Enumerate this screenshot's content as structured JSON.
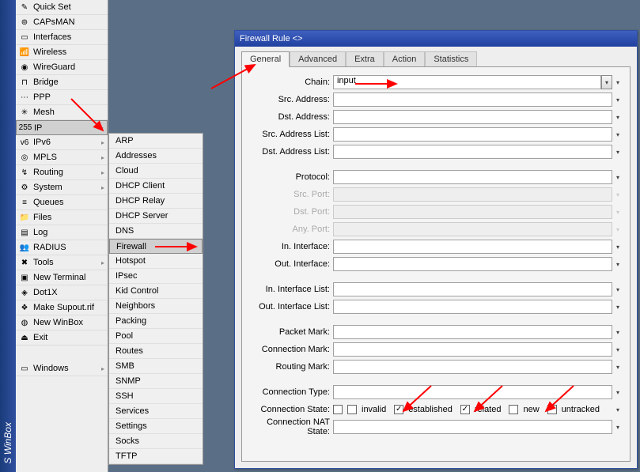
{
  "app": {
    "strip_text": "S WinBox"
  },
  "menu1": [
    {
      "icon": "✎",
      "label": "Quick Set",
      "arrow": false
    },
    {
      "icon": "⊚",
      "label": "CAPsMAN",
      "arrow": false
    },
    {
      "icon": "▭",
      "label": "Interfaces",
      "arrow": false
    },
    {
      "icon": "📶",
      "label": "Wireless",
      "arrow": false
    },
    {
      "icon": "◉",
      "label": "WireGuard",
      "arrow": false
    },
    {
      "icon": "⊓",
      "label": "Bridge",
      "arrow": false
    },
    {
      "icon": "⋯",
      "label": "PPP",
      "arrow": false
    },
    {
      "icon": "✳",
      "label": "Mesh",
      "arrow": false
    },
    {
      "icon": "255",
      "label": "IP",
      "arrow": true,
      "selected": true
    },
    {
      "icon": "v6",
      "label": "IPv6",
      "arrow": true
    },
    {
      "icon": "◎",
      "label": "MPLS",
      "arrow": true
    },
    {
      "icon": "↯",
      "label": "Routing",
      "arrow": true
    },
    {
      "icon": "⚙",
      "label": "System",
      "arrow": true
    },
    {
      "icon": "≡",
      "label": "Queues",
      "arrow": false
    },
    {
      "icon": "📁",
      "label": "Files",
      "arrow": false
    },
    {
      "icon": "▤",
      "label": "Log",
      "arrow": false
    },
    {
      "icon": "👥",
      "label": "RADIUS",
      "arrow": false
    },
    {
      "icon": "✖",
      "label": "Tools",
      "arrow": true
    },
    {
      "icon": "▣",
      "label": "New Terminal",
      "arrow": false
    },
    {
      "icon": "◈",
      "label": "Dot1X",
      "arrow": false
    },
    {
      "icon": "❖",
      "label": "Make Supout.rif",
      "arrow": false
    },
    {
      "icon": "◍",
      "label": "New WinBox",
      "arrow": false
    },
    {
      "icon": "⏏",
      "label": "Exit",
      "arrow": false
    },
    {
      "spacer": true
    },
    {
      "icon": "▭",
      "label": "Windows",
      "arrow": true
    }
  ],
  "submenu": [
    "ARP",
    "Addresses",
    "Cloud",
    "DHCP Client",
    "DHCP Relay",
    "DHCP Server",
    "DNS",
    "Firewall",
    "Hotspot",
    "IPsec",
    "Kid Control",
    "Neighbors",
    "Packing",
    "Pool",
    "Routes",
    "SMB",
    "SNMP",
    "SSH",
    "Services",
    "Settings",
    "Socks",
    "TFTP"
  ],
  "submenu_highlight": "Firewall",
  "fw": {
    "title": "Firewall Rule <>",
    "tabs": [
      "General",
      "Advanced",
      "Extra",
      "Action",
      "Statistics"
    ],
    "active_tab": "General",
    "fields": {
      "chain": {
        "label": "Chain:",
        "value": "input",
        "enabled": true,
        "drop": "dbl"
      },
      "srcaddr": {
        "label": "Src. Address:",
        "enabled": true
      },
      "dstaddr": {
        "label": "Dst. Address:",
        "enabled": true
      },
      "srclist": {
        "label": "Src. Address List:",
        "enabled": true
      },
      "dstlist": {
        "label": "Dst. Address List:",
        "enabled": true
      },
      "protocol": {
        "label": "Protocol:",
        "enabled": true
      },
      "srcport": {
        "label": "Src. Port:",
        "enabled": false
      },
      "dstport": {
        "label": "Dst. Port:",
        "enabled": false
      },
      "anyport": {
        "label": "Any. Port:",
        "enabled": false
      },
      "inif": {
        "label": "In. Interface:",
        "enabled": true
      },
      "outif": {
        "label": "Out. Interface:",
        "enabled": true
      },
      "iniflist": {
        "label": "In. Interface List:",
        "enabled": true
      },
      "outiflist": {
        "label": "Out. Interface List:",
        "enabled": true
      },
      "pmark": {
        "label": "Packet Mark:",
        "enabled": true
      },
      "cmark": {
        "label": "Connection Mark:",
        "enabled": true
      },
      "rmark": {
        "label": "Routing Mark:",
        "enabled": true
      },
      "ctype": {
        "label": "Connection Type:",
        "enabled": true
      },
      "cstate": {
        "label": "Connection State:"
      },
      "cnat": {
        "label": "Connection NAT State:",
        "enabled": true
      }
    },
    "cstate_options": [
      {
        "label": "invalid",
        "checked": false
      },
      {
        "label": "established",
        "checked": true
      },
      {
        "label": "related",
        "checked": true
      },
      {
        "label": "new",
        "checked": false
      },
      {
        "label": "untracked",
        "checked": true
      }
    ]
  }
}
